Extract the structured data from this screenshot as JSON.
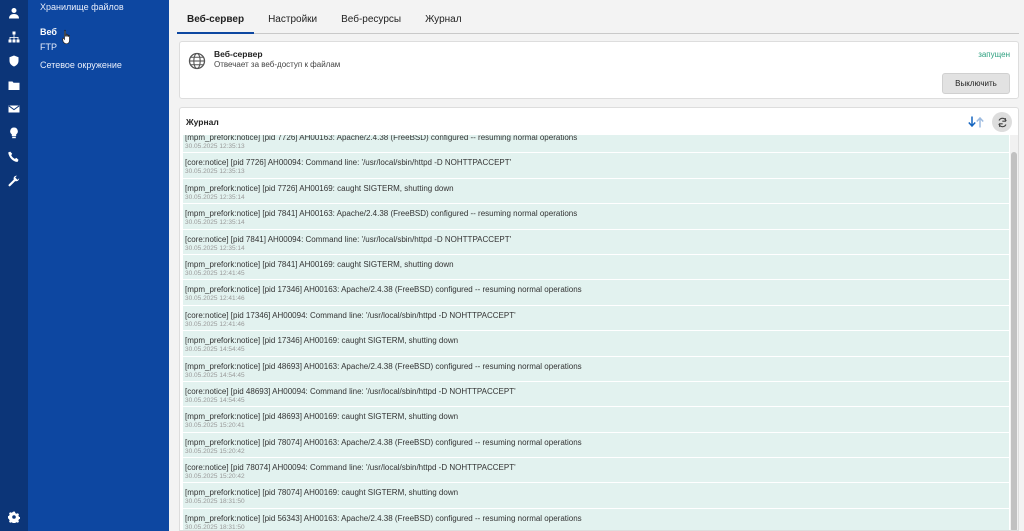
{
  "icons": {
    "user": "user-icon",
    "network": "network-icon",
    "shield": "shield-icon",
    "folder": "folder-icon",
    "mail": "mail-icon",
    "bulb": "lightbulb-icon",
    "phone": "phone-icon",
    "wrench": "wrench-icon",
    "settings": "gear-icon"
  },
  "sidebar": {
    "items": [
      {
        "label": "Хранилище файлов"
      },
      {
        "label": "Веб"
      },
      {
        "label": "FTP"
      },
      {
        "label": "Сетевое окружение"
      }
    ]
  },
  "tabs": [
    {
      "label": "Веб-сервер"
    },
    {
      "label": "Настройки"
    },
    {
      "label": "Веб-ресурсы"
    },
    {
      "label": "Журнал"
    }
  ],
  "server": {
    "title": "Веб-сервер",
    "description": "Отвечает за веб-доступ к файлам",
    "status": "запущен",
    "disable_label": "Выключить"
  },
  "journal": {
    "title": "Журнал",
    "entries": [
      {
        "message": "[mpm_prefork:notice] [pid 7726] AH00163: Apache/2.4.38 (FreeBSD) configured -- resuming normal operations",
        "time": "30.05.2025 12:35:13"
      },
      {
        "message": "[core:notice] [pid 7726] AH00094: Command line: '/usr/local/sbin/httpd -D NOHTTPACCEPT'",
        "time": "30.05.2025 12:35:13"
      },
      {
        "message": "[mpm_prefork:notice] [pid 7726] AH00169: caught SIGTERM, shutting down",
        "time": "30.05.2025 12:35:14"
      },
      {
        "message": "[mpm_prefork:notice] [pid 7841] AH00163: Apache/2.4.38 (FreeBSD) configured -- resuming normal operations",
        "time": "30.05.2025 12:35:14"
      },
      {
        "message": "[core:notice] [pid 7841] AH00094: Command line: '/usr/local/sbin/httpd -D NOHTTPACCEPT'",
        "time": "30.05.2025 12:35:14"
      },
      {
        "message": "[mpm_prefork:notice] [pid 7841] AH00169: caught SIGTERM, shutting down",
        "time": "30.05.2025 12:41:45"
      },
      {
        "message": "[mpm_prefork:notice] [pid 17346] AH00163: Apache/2.4.38 (FreeBSD) configured -- resuming normal operations",
        "time": "30.05.2025 12:41:46"
      },
      {
        "message": "[core:notice] [pid 17346] AH00094: Command line: '/usr/local/sbin/httpd -D NOHTTPACCEPT'",
        "time": "30.05.2025 12:41:46"
      },
      {
        "message": "[mpm_prefork:notice] [pid 17346] AH00169: caught SIGTERM, shutting down",
        "time": "30.05.2025 14:54:45"
      },
      {
        "message": "[mpm_prefork:notice] [pid 48693] AH00163: Apache/2.4.38 (FreeBSD) configured -- resuming normal operations",
        "time": "30.05.2025 14:54:45"
      },
      {
        "message": "[core:notice] [pid 48693] AH00094: Command line: '/usr/local/sbin/httpd -D NOHTTPACCEPT'",
        "time": "30.05.2025 14:54:45"
      },
      {
        "message": "[mpm_prefork:notice] [pid 48693] AH00169: caught SIGTERM, shutting down",
        "time": "30.05.2025 15:20:41"
      },
      {
        "message": "[mpm_prefork:notice] [pid 78074] AH00163: Apache/2.4.38 (FreeBSD) configured -- resuming normal operations",
        "time": "30.05.2025 15:20:42"
      },
      {
        "message": "[core:notice] [pid 78074] AH00094: Command line: '/usr/local/sbin/httpd -D NOHTTPACCEPT'",
        "time": "30.05.2025 15:20:42"
      },
      {
        "message": "[mpm_prefork:notice] [pid 78074] AH00169: caught SIGTERM, shutting down",
        "time": "30.05.2025 18:31:50"
      },
      {
        "message": "[mpm_prefork:notice] [pid 56343] AH00163: Apache/2.4.38 (FreeBSD) configured -- resuming normal operations",
        "time": "30.05.2025 18:31:50"
      }
    ]
  }
}
